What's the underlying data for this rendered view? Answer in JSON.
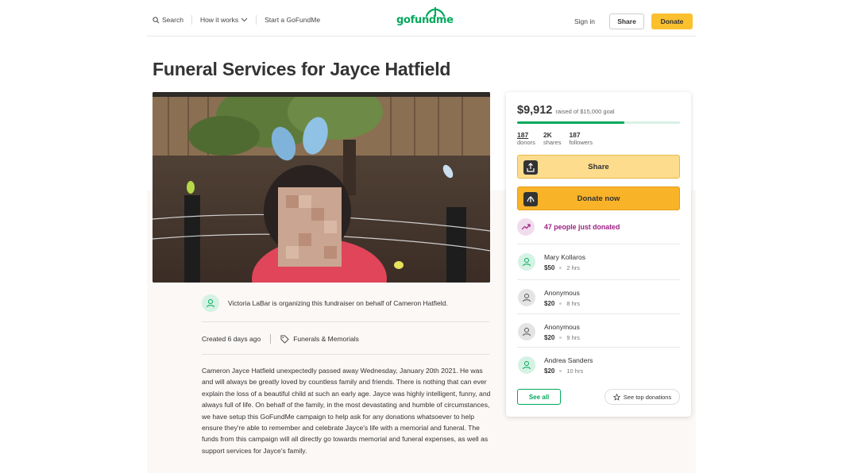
{
  "header": {
    "search_label": "Search",
    "how_it_works_label": "How it works",
    "start_label": "Start a GoFundMe",
    "logo_text": "gofundme",
    "signin_label": "Sign in",
    "share_label": "Share",
    "donate_label": "Donate"
  },
  "campaign": {
    "title": "Funeral Services for Jayce Hatfield",
    "organizer_text": "Victoria LaBar is organizing this fundraiser on behalf of Cameron Hatfield.",
    "created": "Created 6 days ago",
    "category": "Funerals & Memorials",
    "story": "Cameron Jayce Hatfield unexpectedly passed away Wednesday, January 20th 2021. He was and will always be greatly loved by countless family and friends. There is nothing that can ever explain the loss of a beautiful child at such an early age. Jayce was highly intelligent, funny, and always full of life. On behalf of the family, in the most devastating and humble of circumstances, we have setup this GoFundMe campaign to help ask for any donations whatsoever to help ensure they're able to remember and celebrate Jayce's life with a memorial and funeral. The funds from this campaign will all directly go towards memorial and funeral expenses, as well as support services for Jayce's family."
  },
  "card": {
    "raised": "$9,912",
    "goal_text": "raised of $15,000 goal",
    "progress_fraction": 0.66,
    "stats": [
      {
        "num": "187",
        "label": "donors"
      },
      {
        "num": "2K",
        "label": "shares"
      },
      {
        "num": "187",
        "label": "followers"
      }
    ],
    "share_button": "Share",
    "donate_button": "Donate now",
    "trend_text": "47 people just donated",
    "donations": [
      {
        "name": "Mary Kollaros",
        "amount": "$50",
        "time": "2 hrs"
      },
      {
        "name": "Anonymous",
        "amount": "$20",
        "time": "8 hrs"
      },
      {
        "name": "Anonymous",
        "amount": "$20",
        "time": "9 hrs"
      },
      {
        "name": "Andrea Sanders",
        "amount": "$20",
        "time": "10 hrs"
      }
    ],
    "see_all": "See all",
    "see_top": "See top donations"
  },
  "colors": {
    "brand_green": "#02a95c",
    "donate_yellow": "#f9b328",
    "trend_purple": "#9c1f82"
  }
}
